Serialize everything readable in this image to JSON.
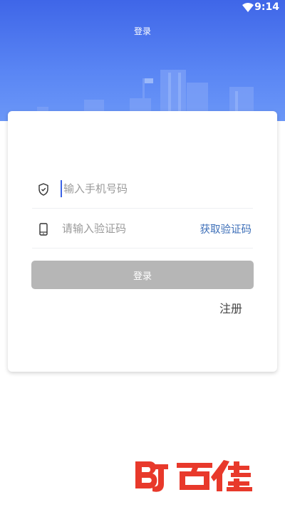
{
  "status_bar": {
    "time": "9:14",
    "wifi_icon": "wifi-icon"
  },
  "header": {
    "title": "登录",
    "gradient_top": "#3f66e8",
    "gradient_bottom": "#6b97f7"
  },
  "form": {
    "phone": {
      "placeholder": "输入手机号码",
      "icon": "shield-icon"
    },
    "code": {
      "placeholder": "请输入验证码",
      "icon": "phone-icon",
      "get_code_label": "获取验证码"
    },
    "login_label": "登录",
    "register_label": "注册"
  },
  "watermark": {
    "brand_color": "#e8392b"
  }
}
